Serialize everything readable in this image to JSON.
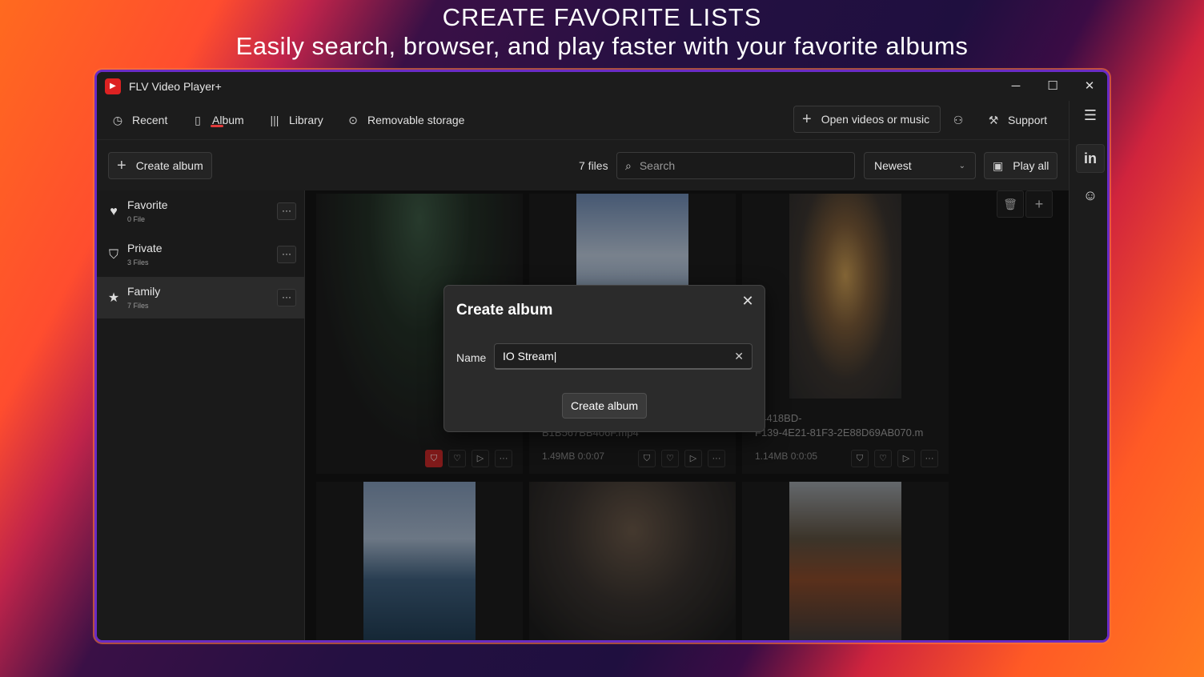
{
  "promo": {
    "title": "CREATE FAVORITE LISTS",
    "subtitle": "Easily search, browser, and play faster with your favorite albums"
  },
  "app": {
    "title": "FLV Video Player+",
    "logo_text": "FLV"
  },
  "nav": {
    "items": [
      {
        "label": "Recent",
        "icon": "clock-icon"
      },
      {
        "label": "Album",
        "icon": "album-icon",
        "active": true
      },
      {
        "label": "Library",
        "icon": "library-icon"
      },
      {
        "label": "Removable storage",
        "icon": "disc-icon"
      }
    ],
    "open_label": "Open videos or music",
    "support_label": "Support"
  },
  "toolbar": {
    "create_album_label": "Create album",
    "file_count": "7 files",
    "search_placeholder": "Search",
    "sort_value": "Newest",
    "play_all_label": "Play all"
  },
  "albums": [
    {
      "name": "Favorite",
      "count": "0 File",
      "icon": "heart-icon"
    },
    {
      "name": "Private",
      "count": "3 Files",
      "icon": "shield-icon"
    },
    {
      "name": "Family",
      "count": "7 Files",
      "icon": "star-icon",
      "selected": true
    }
  ],
  "files": [
    {
      "name": "",
      "meta": ""
    },
    {
      "name": "B1B567BB406F.mp4",
      "meta": "1.49MB  0:0:07"
    },
    {
      "name": "54418BD-\nF139-4E21-81F3-2E88D69AB070.m",
      "meta": "1.14MB  0:0:05"
    }
  ],
  "dialog": {
    "title": "Create album",
    "name_label": "Name",
    "name_value": "IO Stream",
    "submit_label": "Create album"
  },
  "colors": {
    "accent": "#e23a3a",
    "window_bg": "#1c1c1c",
    "border": "#6a2bc4"
  }
}
